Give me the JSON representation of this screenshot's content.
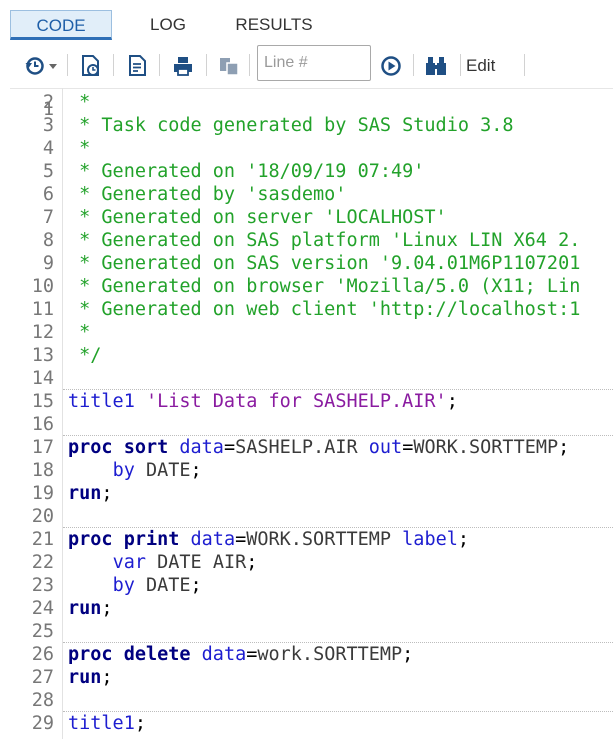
{
  "tabs": [
    {
      "label": "CODE",
      "active": true
    },
    {
      "label": "LOG",
      "active": false
    },
    {
      "label": "RESULTS",
      "active": false
    }
  ],
  "toolbar": {
    "icons": [
      "history-icon",
      "run-file-icon",
      "format-code-icon",
      "print-icon",
      "copy-icon",
      "go-to-line-icon",
      "snippets-icon"
    ],
    "line_placeholder": "Line #",
    "edit_label": "Edit"
  },
  "editor": {
    "first_line_partial": "1",
    "lines": [
      {
        "n": "2",
        "segs": [
          {
            "c": "cm",
            "t": " *"
          }
        ]
      },
      {
        "n": "3",
        "segs": [
          {
            "c": "cm",
            "t": " * Task code generated by SAS Studio 3.8"
          }
        ]
      },
      {
        "n": "4",
        "segs": [
          {
            "c": "cm",
            "t": " *"
          }
        ]
      },
      {
        "n": "5",
        "segs": [
          {
            "c": "cm",
            "t": " * Generated on '18/09/19 07:49'"
          }
        ]
      },
      {
        "n": "6",
        "segs": [
          {
            "c": "cm",
            "t": " * Generated by 'sasdemo'"
          }
        ]
      },
      {
        "n": "7",
        "segs": [
          {
            "c": "cm",
            "t": " * Generated on server 'LOCALHOST'"
          }
        ]
      },
      {
        "n": "8",
        "segs": [
          {
            "c": "cm",
            "t": " * Generated on SAS platform 'Linux LIN X64 2."
          }
        ]
      },
      {
        "n": "9",
        "segs": [
          {
            "c": "cm",
            "t": " * Generated on SAS version '9.04.01M6P1107201"
          }
        ]
      },
      {
        "n": "10",
        "segs": [
          {
            "c": "cm",
            "t": " * Generated on browser 'Mozilla/5.0 (X11; Lin"
          }
        ]
      },
      {
        "n": "11",
        "segs": [
          {
            "c": "cm",
            "t": " * Generated on web client 'http://localhost:1"
          }
        ]
      },
      {
        "n": "12",
        "segs": [
          {
            "c": "cm",
            "t": " *"
          }
        ]
      },
      {
        "n": "13",
        "segs": [
          {
            "c": "cm",
            "t": " */"
          }
        ]
      },
      {
        "n": "14",
        "segs": []
      },
      {
        "n": "15",
        "sect": true,
        "segs": [
          {
            "c": "op",
            "t": "title1"
          },
          {
            "c": "tx",
            "t": " "
          },
          {
            "c": "st",
            "t": "'List Data for SASHELP.AIR'"
          },
          {
            "c": "tx",
            "t": ";"
          }
        ]
      },
      {
        "n": "16",
        "segs": []
      },
      {
        "n": "17",
        "sect": true,
        "segs": [
          {
            "c": "kw",
            "t": "proc sort"
          },
          {
            "c": "tx",
            "t": " "
          },
          {
            "c": "op",
            "t": "data"
          },
          {
            "c": "tx",
            "t": "="
          },
          {
            "c": "nm",
            "t": "SASHELP.AIR"
          },
          {
            "c": "tx",
            "t": " "
          },
          {
            "c": "op",
            "t": "out"
          },
          {
            "c": "tx",
            "t": "="
          },
          {
            "c": "nm",
            "t": "WORK.SORTTEMP"
          },
          {
            "c": "tx",
            "t": ";"
          }
        ]
      },
      {
        "n": "18",
        "segs": [
          {
            "c": "tx",
            "t": "    "
          },
          {
            "c": "op",
            "t": "by"
          },
          {
            "c": "tx",
            "t": " "
          },
          {
            "c": "nm",
            "t": "DATE"
          },
          {
            "c": "tx",
            "t": ";"
          }
        ]
      },
      {
        "n": "19",
        "segs": [
          {
            "c": "kw",
            "t": "run"
          },
          {
            "c": "tx",
            "t": ";"
          }
        ]
      },
      {
        "n": "20",
        "segs": []
      },
      {
        "n": "21",
        "sect": true,
        "segs": [
          {
            "c": "kw",
            "t": "proc print"
          },
          {
            "c": "tx",
            "t": " "
          },
          {
            "c": "op",
            "t": "data"
          },
          {
            "c": "tx",
            "t": "="
          },
          {
            "c": "nm",
            "t": "WORK.SORTTEMP"
          },
          {
            "c": "tx",
            "t": " "
          },
          {
            "c": "op",
            "t": "label"
          },
          {
            "c": "tx",
            "t": ";"
          }
        ]
      },
      {
        "n": "22",
        "segs": [
          {
            "c": "tx",
            "t": "    "
          },
          {
            "c": "op",
            "t": "var"
          },
          {
            "c": "tx",
            "t": " "
          },
          {
            "c": "nm",
            "t": "DATE AIR"
          },
          {
            "c": "tx",
            "t": ";"
          }
        ]
      },
      {
        "n": "23",
        "segs": [
          {
            "c": "tx",
            "t": "    "
          },
          {
            "c": "op",
            "t": "by"
          },
          {
            "c": "tx",
            "t": " "
          },
          {
            "c": "nm",
            "t": "DATE"
          },
          {
            "c": "tx",
            "t": ";"
          }
        ]
      },
      {
        "n": "24",
        "segs": [
          {
            "c": "kw",
            "t": "run"
          },
          {
            "c": "tx",
            "t": ";"
          }
        ]
      },
      {
        "n": "25",
        "segs": []
      },
      {
        "n": "26",
        "sect": true,
        "segs": [
          {
            "c": "kw",
            "t": "proc delete"
          },
          {
            "c": "tx",
            "t": " "
          },
          {
            "c": "op",
            "t": "data"
          },
          {
            "c": "tx",
            "t": "="
          },
          {
            "c": "nm",
            "t": "work.SORTTEMP"
          },
          {
            "c": "tx",
            "t": ";"
          }
        ]
      },
      {
        "n": "27",
        "segs": [
          {
            "c": "kw",
            "t": "run"
          },
          {
            "c": "tx",
            "t": ";"
          }
        ]
      },
      {
        "n": "28",
        "segs": []
      },
      {
        "n": "29",
        "sect": true,
        "segs": [
          {
            "c": "op",
            "t": "title1"
          },
          {
            "c": "tx",
            "t": ";"
          }
        ]
      }
    ]
  }
}
